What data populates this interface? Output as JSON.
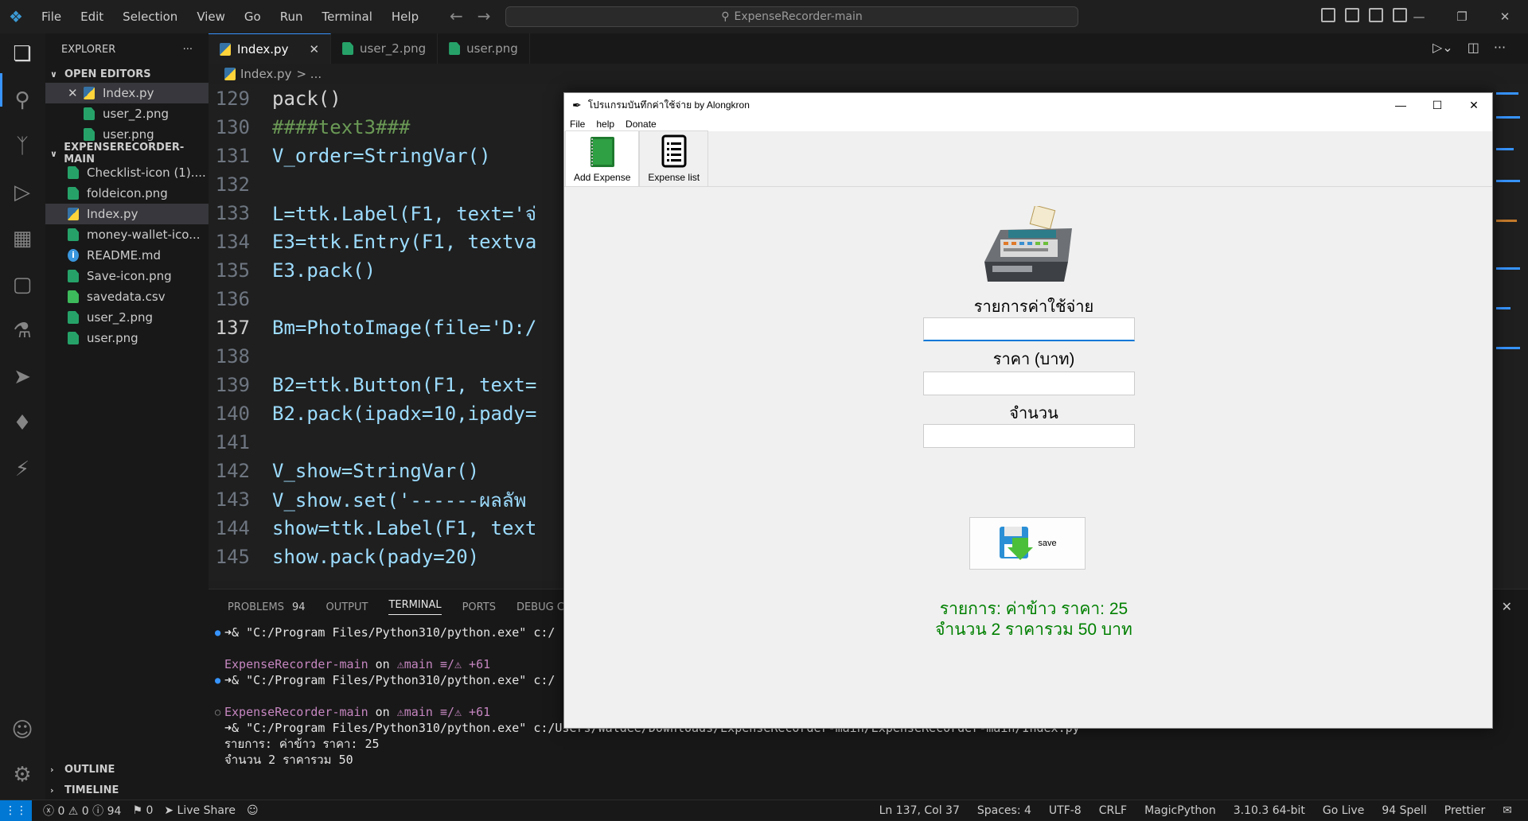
{
  "menubar": {
    "items": [
      "File",
      "Edit",
      "Selection",
      "View",
      "Go",
      "Run",
      "Terminal",
      "Help"
    ]
  },
  "command_center": {
    "text": "ExpenseRecorder-main"
  },
  "sidebar": {
    "title": "EXPLORER",
    "more": "···",
    "open_editors_label": "OPEN EDITORS",
    "open_editors": [
      "Index.py",
      "user_2.png",
      "user.png"
    ],
    "project_label": "EXPENSERECORDER-MAIN",
    "files": [
      {
        "name": "Checklist-icon (1)....",
        "type": "img"
      },
      {
        "name": "foldeicon.png",
        "type": "img"
      },
      {
        "name": "Index.py",
        "type": "py"
      },
      {
        "name": "money-wallet-ico...",
        "type": "img"
      },
      {
        "name": "README.md",
        "type": "md"
      },
      {
        "name": "Save-icon.png",
        "type": "img"
      },
      {
        "name": "savedata.csv",
        "type": "csv"
      },
      {
        "name": "user_2.png",
        "type": "img"
      },
      {
        "name": "user.png",
        "type": "img"
      }
    ],
    "outline_label": "OUTLINE",
    "timeline_label": "TIMELINE"
  },
  "tabs": [
    "Index.py",
    "user_2.png",
    "user.png"
  ],
  "breadcrumb": {
    "file": "Index.py",
    "rest": "> ..."
  },
  "code_lines": [
    {
      "n": "129",
      "text": "    pack()"
    },
    {
      "n": "130",
      "text": "####text3###"
    },
    {
      "n": "131",
      "text": "V_order=StringVar()"
    },
    {
      "n": "132",
      "text": ""
    },
    {
      "n": "133",
      "text": "L=ttk.Label(F1, text='จ่"
    },
    {
      "n": "134",
      "text": "E3=ttk.Entry(F1, textva"
    },
    {
      "n": "135",
      "text": "E3.pack()"
    },
    {
      "n": "136",
      "text": ""
    },
    {
      "n": "137",
      "text": "Bm=PhotoImage(file='D:/"
    },
    {
      "n": "138",
      "text": ""
    },
    {
      "n": "139",
      "text": "B2=ttk.Button(F1, text="
    },
    {
      "n": "140",
      "text": "B2.pack(ipadx=10,ipady="
    },
    {
      "n": "141",
      "text": ""
    },
    {
      "n": "142",
      "text": "V_show=StringVar()"
    },
    {
      "n": "143",
      "text": "V_show.set('------ผลลัพ"
    },
    {
      "n": "144",
      "text": "show=ttk.Label(F1, text"
    },
    {
      "n": "145",
      "text": "show.pack(pady=20)"
    }
  ],
  "panel": {
    "tabs": [
      "PROBLEMS",
      "OUTPUT",
      "TERMINAL",
      "PORTS",
      "DEBUG CO"
    ],
    "problems_count": "94",
    "terminal": {
      "l1_cmd": "➜& \"C:/Program Files/Python310/python.exe\" c:/",
      "l2_project": "ExpenseRecorder-main",
      "l2_on": "on",
      "l2_branch": "⚠main ≡/⚠ +61",
      "l3_cmd": "➜& \"C:/Program Files/Python310/python.exe\" c:/",
      "l4_project": "ExpenseRecorder-main",
      "l4_on": "on",
      "l4_branch": "⚠main ≡/⚠ +61",
      "l5_cmd": "➜& \"C:/Program Files/Python310/python.exe\"",
      "l5_path": "c:/Users/Waldee/Downloads/ExpenseRecorder-main/ExpenseRecorder-main/Index.py",
      "l6": "รายการ: ค่าข้าว ราคา: 25",
      "l7": "จำนวน 2 ราคารวม 50"
    }
  },
  "statusbar": {
    "problems": "ⓧ 0 ⚠ 0 ⓘ 94",
    "ports": "⚑ 0",
    "liveshare": "Live Share",
    "position": "Ln 137, Col 37",
    "spaces": "Spaces: 4",
    "encoding": "UTF-8",
    "eol": "CRLF",
    "language": "MagicPython",
    "python": "3.10.3 64-bit",
    "golive": "Go Live",
    "spell": "94 Spell",
    "prettier": "Prettier"
  },
  "tkapp": {
    "title": "โปรแกรมบันทึกค่าใช้จ่าย by Alongkron",
    "menu": [
      "File",
      "help",
      "Donate"
    ],
    "tabs": [
      "Add Expense",
      "Expense list"
    ],
    "label_item": "รายการค่าใช้จ่าย",
    "label_price": "ราคา (บาท)",
    "label_qty": "จำนวน",
    "save_label": "save",
    "result_line1": "รายการ: ค่าข้าว ราคา: 25",
    "result_line2": "จำนวน 2 ราคารวม 50 บาท"
  },
  "colors": {
    "accent": "#0078d4",
    "result_green": "#008000"
  }
}
